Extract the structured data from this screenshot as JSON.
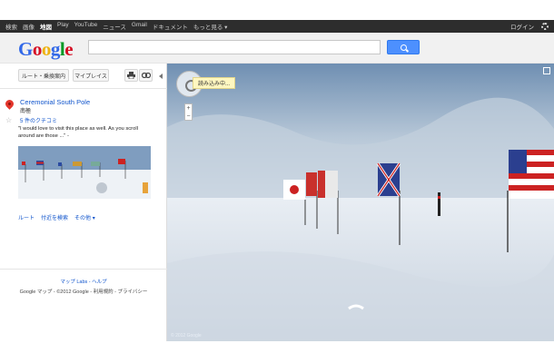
{
  "topbar": {
    "nav": [
      "検索",
      "画像",
      "地図",
      "Play",
      "YouTube",
      "ニュース",
      "Gmail",
      "ドキュメント",
      "もっと見る ▾"
    ],
    "active_index": 2,
    "login": "ログイン"
  },
  "header": {
    "logo_letters": [
      "G",
      "o",
      "o",
      "g",
      "l",
      "e"
    ]
  },
  "sidebar": {
    "route_button": "ルート・乗換案内",
    "my_places_button": "マイプレイス",
    "place": {
      "title": "Ceremonial South Pole",
      "subtitle": "南極",
      "reviews": "5 件のクチコミ",
      "quote": "\"I would love to visit this place as well. As you scroll around are those ...\" -"
    },
    "links": [
      "ルート",
      "付近を検索",
      "その他 ▾"
    ],
    "footer_links": "マップ Labs - ヘルプ",
    "footer_copy": "Google マップ - ©2012 Google - 利用規約 - プライバシー"
  },
  "streetview": {
    "loading_text": "読み込み中...",
    "zoom_plus": "+",
    "zoom_minus": "−",
    "copyright": "© 2012 Google"
  },
  "colors": {
    "accent_blue": "#4d90fe",
    "link_blue": "#1155cc",
    "topbar_bg": "#2d2d2d"
  }
}
